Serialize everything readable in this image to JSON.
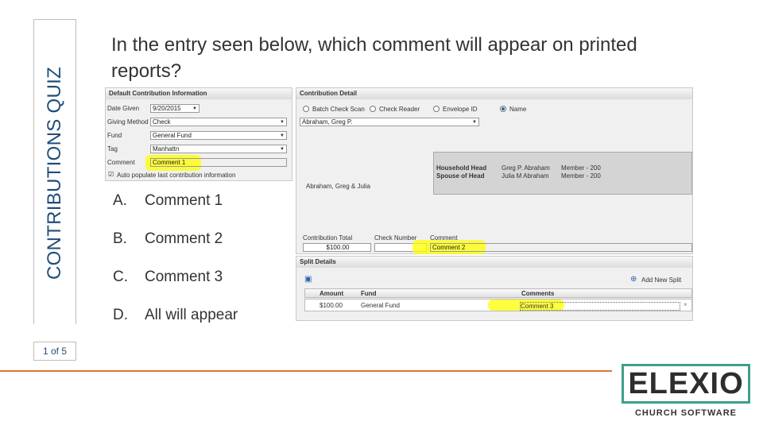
{
  "slide": {
    "side_title": "CONTRIBUTIONS QUIZ",
    "page_indicator": "1 of 5",
    "question": "In the entry seen below, which comment will appear on printed reports?"
  },
  "default_panel": {
    "header": "Default Contribution Information",
    "date_label": "Date Given",
    "date_value": "9/20/2015",
    "method_label": "Giving Method",
    "method_value": "Check",
    "fund_label": "Fund",
    "fund_value": "General Fund",
    "tag_label": "Tag",
    "tag_value": "Manhattn",
    "comment_label": "Comment",
    "comment_value": "Comment 1",
    "autopop_label": "Auto populate last contribution information"
  },
  "detail_panel": {
    "header": "Contribution Detail",
    "radio_options": [
      "Batch Check Scan",
      "Check Reader",
      "Envelope ID",
      "Name"
    ],
    "selected_radio": "Name",
    "name_value": "Abraham, Greg P.",
    "household_head_label": "Household Head",
    "household_head_name": "Greg P. Abraham",
    "household_head_status": "Member - 200",
    "spouse_label": "Spouse of Head",
    "spouse_name": "Julia M Abraham",
    "spouse_status": "Member - 200",
    "family_name": "Abraham, Greg & Julia",
    "total_label": "Contribution Total",
    "total_value": "$100.00",
    "check_label": "Check Number",
    "check_value": "",
    "comment_label": "Comment",
    "comment_value": "Comment 2"
  },
  "split_panel": {
    "header": "Split Details",
    "add_split_label": "Add New Split",
    "columns": [
      "Amount",
      "Fund",
      "Comments"
    ],
    "row": {
      "amount": "$100.00",
      "fund": "General Fund",
      "comment": "Comment 3"
    },
    "remove_glyph": "×"
  },
  "answers": [
    {
      "letter": "A.",
      "text": "Comment 1"
    },
    {
      "letter": "B.",
      "text": "Comment 2"
    },
    {
      "letter": "C.",
      "text": "Comment 3"
    },
    {
      "letter": "D.",
      "text": "All will appear"
    }
  ],
  "logo": {
    "wordmark": "ELEXIO",
    "tagline": "CHURCH SOFTWARE"
  },
  "colors": {
    "title_blue": "#1f4e79",
    "footer_orange": "#d9772e",
    "logo_teal": "#3f9e8a",
    "highlight": "#ffff00"
  }
}
